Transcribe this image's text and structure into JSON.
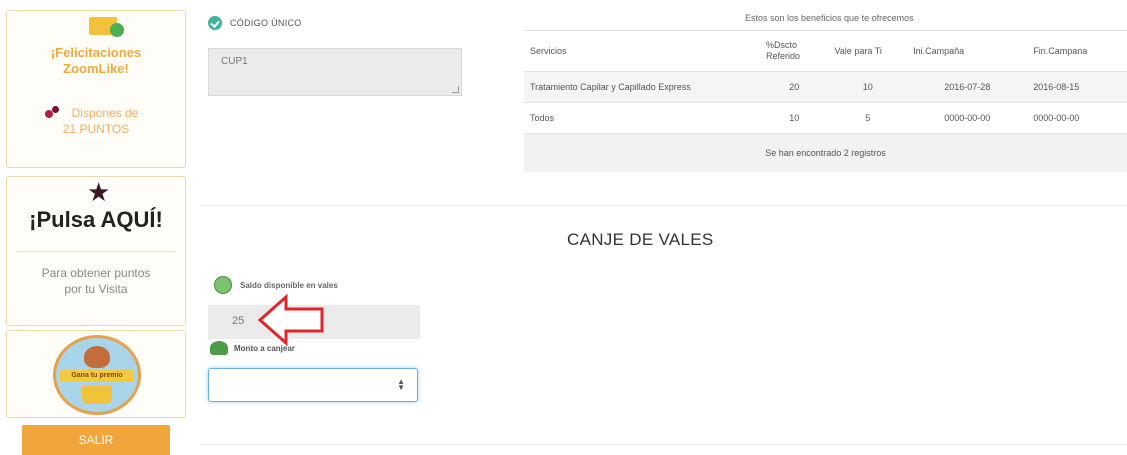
{
  "sidebar": {
    "congrats_line1": "¡Felicitaciones",
    "congrats_line2": "ZoomLike!",
    "points_line1": "Dispones de",
    "points_line2": "21 PUNTOS",
    "pulsa_title": "¡Pulsa AQUÍ!",
    "pulsa_sub_line1": "Para obtener puntos",
    "pulsa_sub_line2": "por tu Visita",
    "badge_text": "Gana tu premio",
    "salir_label": "SALIR"
  },
  "codigo": {
    "label": "CÓDIGO ÚNICO",
    "value": "CUP1"
  },
  "benefits": {
    "caption": "Estos son los beneficios que te ofrecemos",
    "headers": [
      "Servicios",
      "%Dscto Referido",
      "Vale para Ti",
      "Ini.Campaña",
      "Fin.Campana"
    ],
    "rows": [
      [
        "Tratamiento Capilar y Capillado Express",
        "20",
        "10",
        "2016-07-28",
        "2016-08-15"
      ],
      [
        "Todos",
        "10",
        "5",
        "0000-00-00",
        "0000-00-00"
      ]
    ],
    "footer": "Se han encontrado 2 registros"
  },
  "canje": {
    "title": "CANJE DE VALES",
    "saldo_label": "Saldo disponible en vales",
    "saldo_value": "25",
    "monto_label": "Monto a canjear",
    "monto_value": ""
  },
  "colors": {
    "accent_orange": "#f1a63d",
    "check_green": "#3fb39b",
    "arrow_red": "#e0262c"
  }
}
